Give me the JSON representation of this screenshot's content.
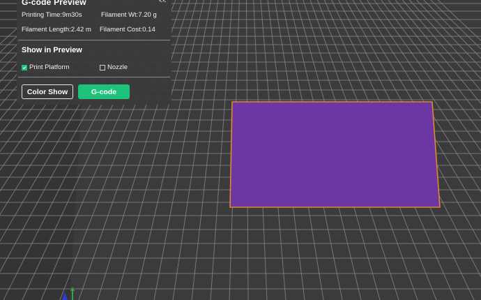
{
  "preview_panel": {
    "title": "G-code Preview",
    "collapse_label": "<<",
    "stats": {
      "printing_time": "Printing Time:9m30s",
      "filament_weight": "Filament Wt:7.20 g",
      "filament_length": "Filament Length:2.42 m",
      "filament_cost": "Filament Cost:0.14"
    },
    "show_in_preview": {
      "title": "Show in Preview",
      "options": [
        {
          "label": "Print Platform",
          "checked": true
        },
        {
          "label": "Nozzle",
          "checked": false
        }
      ]
    },
    "buttons": {
      "color_show": "Color Show",
      "gcode": "G-code"
    }
  },
  "colors": {
    "accent": "#1ec27a",
    "print_fill": "#6b33a3",
    "print_outline": "#e0882e",
    "background": "#3b3b3d",
    "grid_line": "#8c8c8c"
  }
}
